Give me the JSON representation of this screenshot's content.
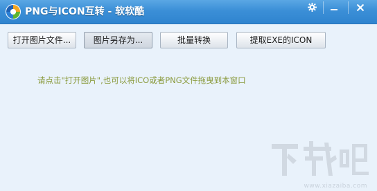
{
  "window": {
    "title": "PNG与ICON互转 - 软软酷",
    "logo_icon": "app-logo-icon",
    "controls": {
      "settings_icon": "gear-icon",
      "minimize_icon": "minimize-icon",
      "close_icon": "close-icon"
    }
  },
  "toolbar": {
    "open_label": "打开图片文件...",
    "save_as_label": "图片另存为...",
    "batch_label": "批量转换",
    "extract_label": "提取EXE的ICON"
  },
  "main": {
    "hint": "请点击\"打开图片\",也可以将ICO或者PNG文件拖曳到本窗口"
  },
  "watermark": {
    "logo": "下载吧",
    "url": "www.xiazaiba.com"
  },
  "colors": {
    "titlebar": "#3b8fd7",
    "background": "#e9f2fb",
    "hint_text": "#8a9a3c"
  }
}
